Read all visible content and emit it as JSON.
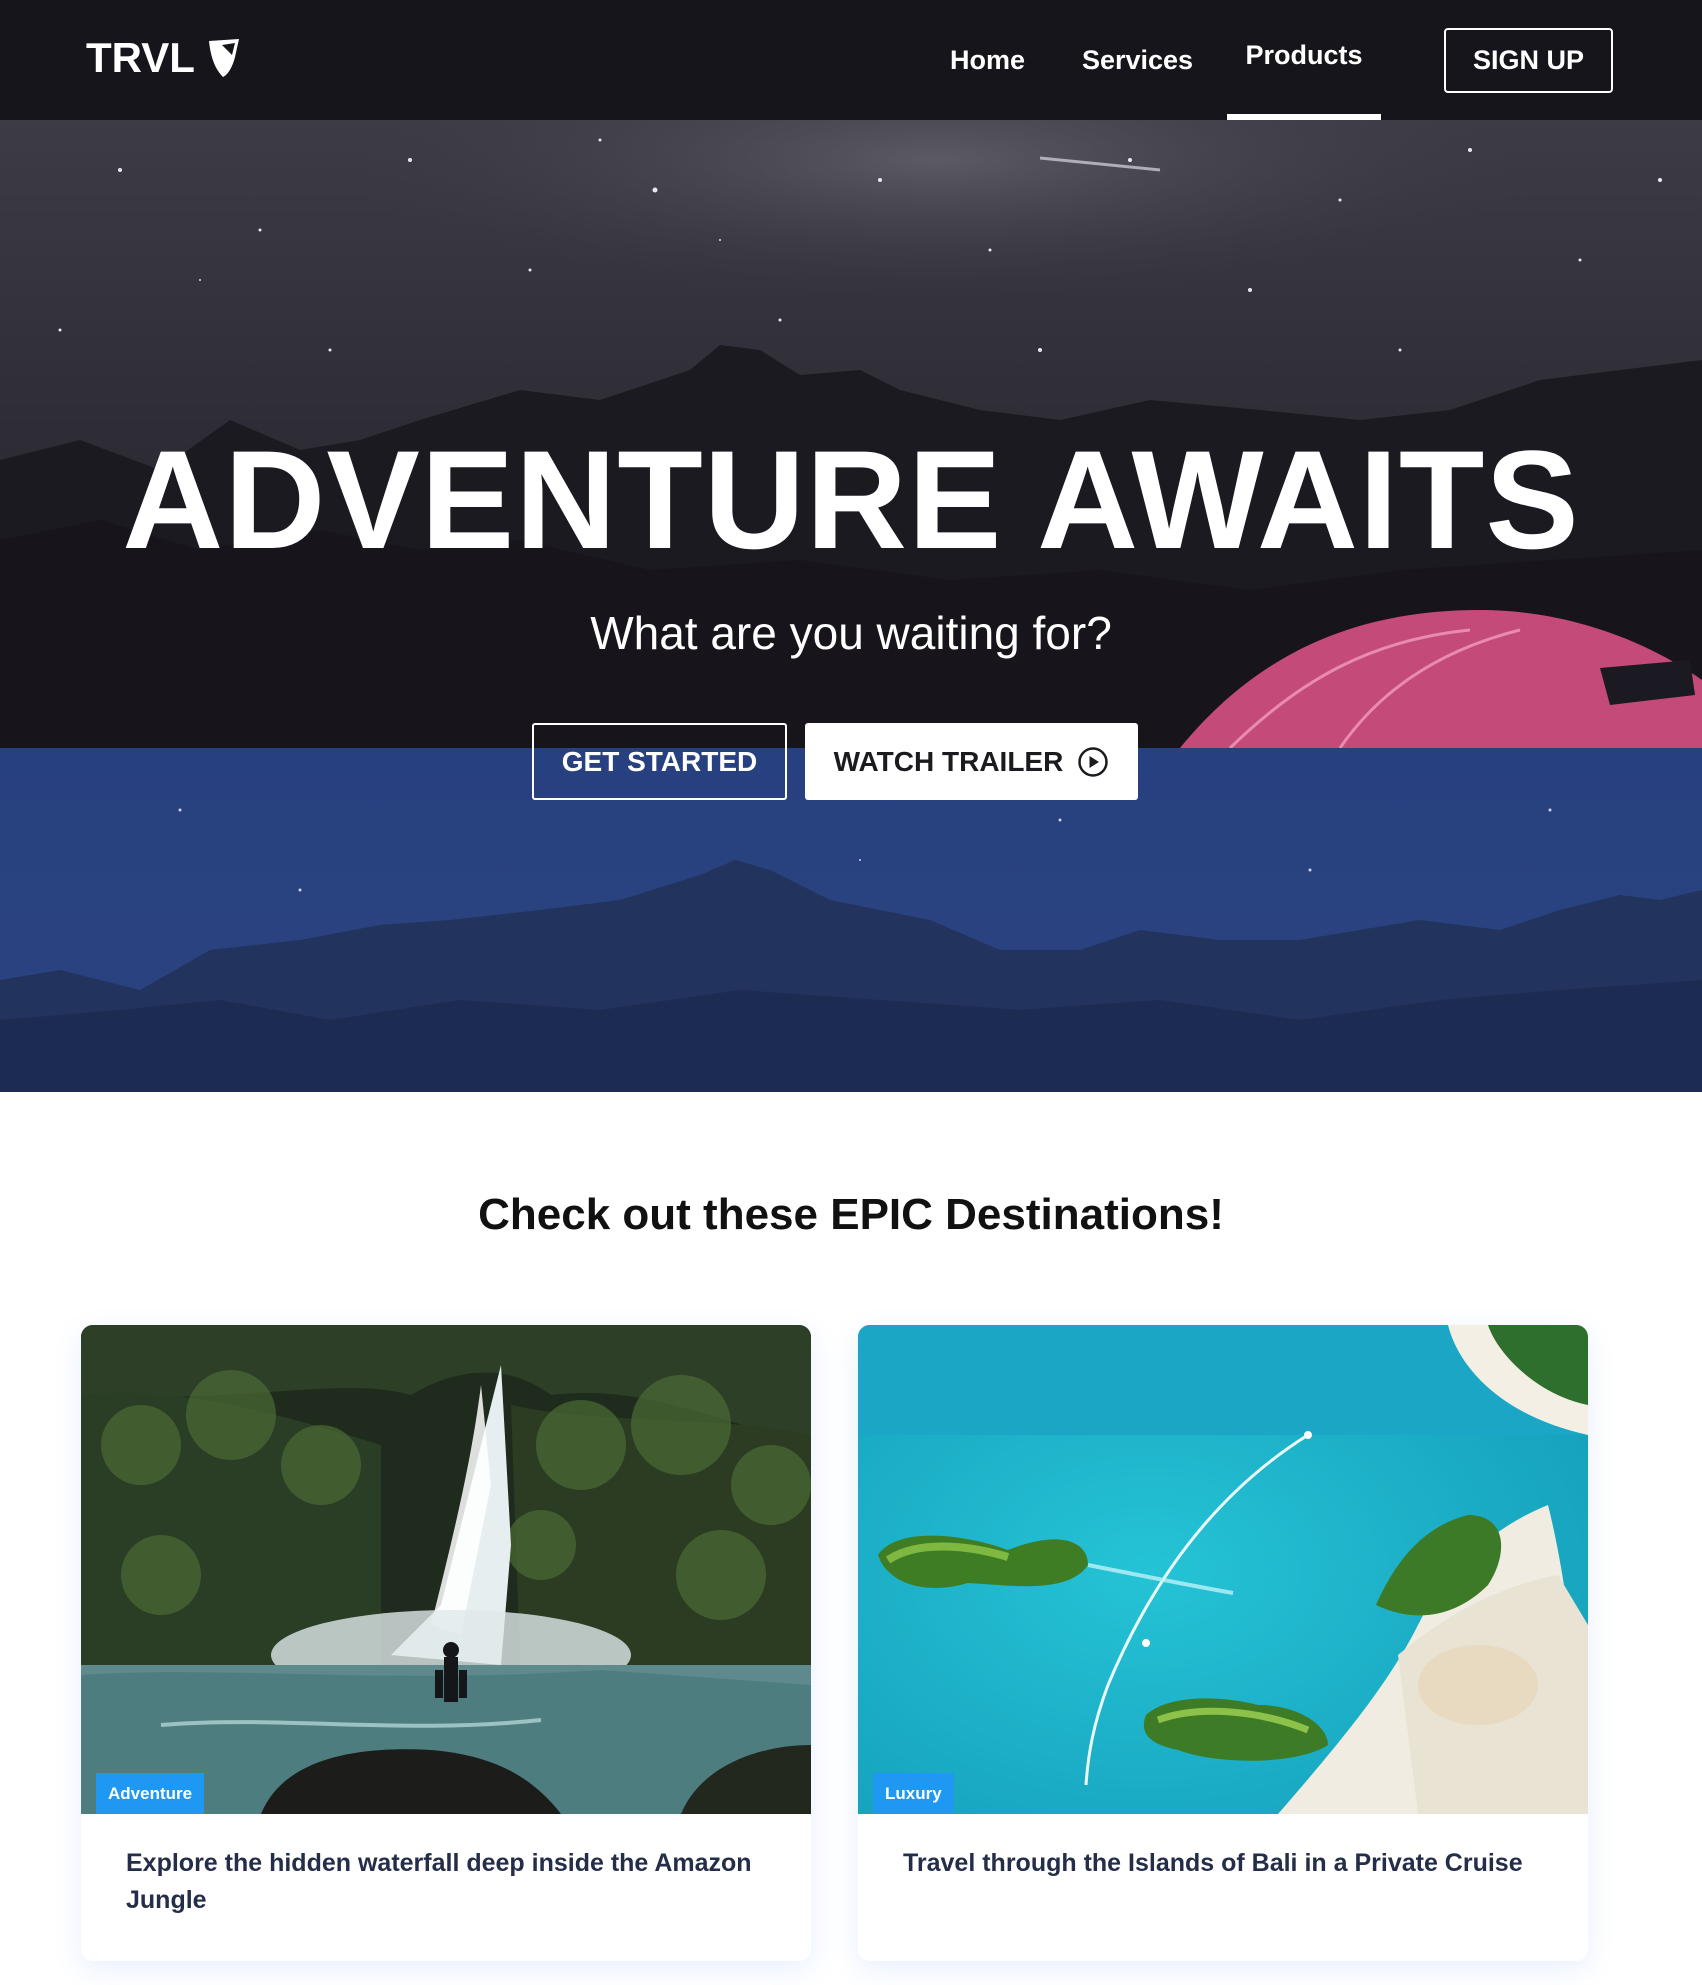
{
  "nav": {
    "logo_text": "TRVL",
    "logo_icon": "shield-icon",
    "links": [
      {
        "label": "Home"
      },
      {
        "label": "Services"
      },
      {
        "label": "Products",
        "active": true
      }
    ],
    "signup_label": "SIGN UP"
  },
  "hero": {
    "title": "ADVENTURE AWAITS",
    "subtitle": "What are you waiting for?",
    "get_started_label": "GET STARTED",
    "watch_trailer_label": "WATCH TRAILER",
    "play_icon": "play-circle-icon"
  },
  "destinations": {
    "heading": "Check out these EPIC Destinations!",
    "cards": [
      {
        "badge": "Adventure",
        "text": "Explore the hidden waterfall deep inside the Amazon Jungle"
      },
      {
        "badge": "Luxury",
        "text": "Travel through the Islands of Bali in a Private Cruise"
      }
    ]
  },
  "colors": {
    "nav_bg": "#17151c",
    "badge": "#1f98f4",
    "card_text": "#252e48"
  }
}
